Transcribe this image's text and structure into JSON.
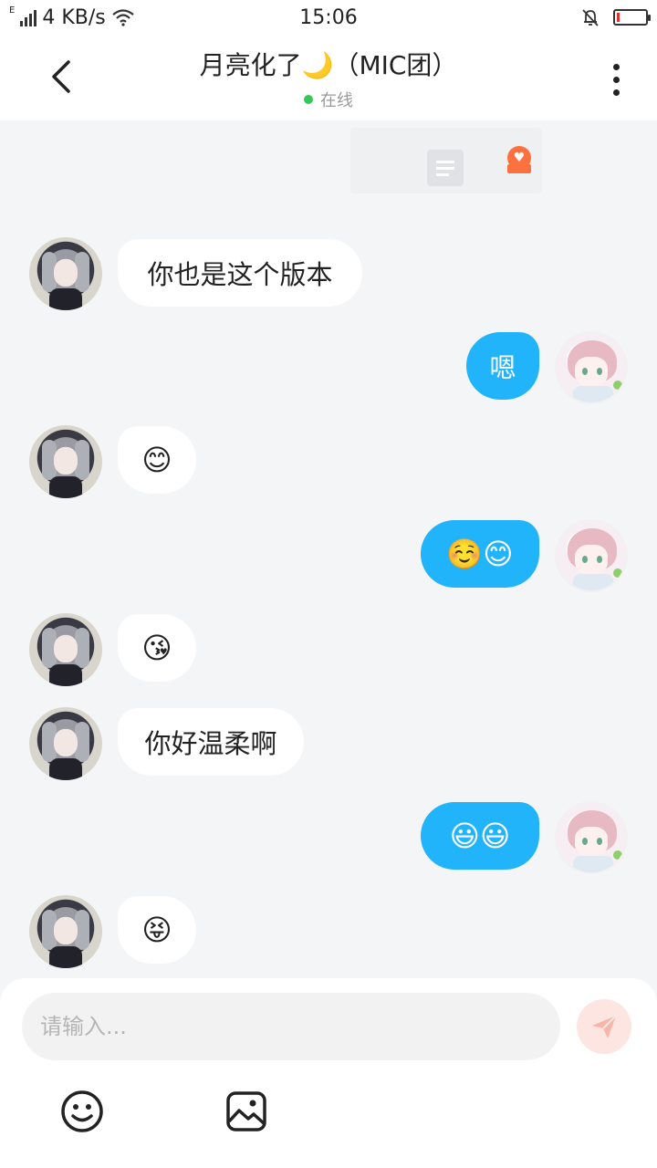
{
  "status_bar": {
    "network_type": "E",
    "speed": "4 KB/s",
    "time": "15:06",
    "battery_color": "#e03030"
  },
  "header": {
    "title": "月亮化了🌙（MIC团）",
    "status": "在线",
    "status_color": "#34c759"
  },
  "messages": [
    {
      "from": "other",
      "type": "text",
      "content": "你也是这个版本"
    },
    {
      "from": "me",
      "type": "text",
      "content": "嗯"
    },
    {
      "from": "other",
      "type": "emoji",
      "content": "😊"
    },
    {
      "from": "me",
      "type": "emoji",
      "content": "☺️😊"
    },
    {
      "from": "other",
      "type": "emoji",
      "content": "😘"
    },
    {
      "from": "other",
      "type": "text",
      "content": "你好温柔啊"
    },
    {
      "from": "me",
      "type": "emoji",
      "content": "😃😃"
    },
    {
      "from": "other",
      "type": "emoji",
      "content": "😝"
    }
  ],
  "composer": {
    "placeholder": "请输入...",
    "send_icon": "send-icon",
    "tools": [
      "emoji-icon",
      "image-icon"
    ]
  },
  "colors": {
    "my_bubble": "#21b4fb",
    "other_bubble": "#ffffff",
    "background": "#f4f5f7"
  }
}
